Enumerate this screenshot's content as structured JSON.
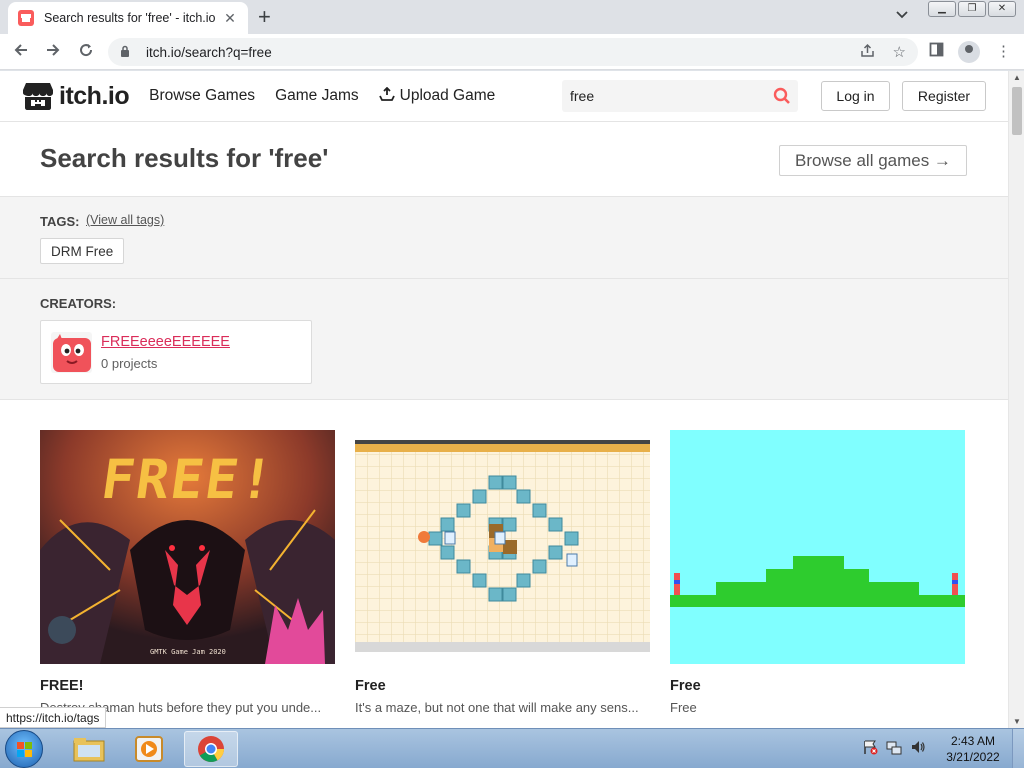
{
  "browser": {
    "tab_title": "Search results for 'free' - itch.io",
    "url": "itch.io/search?q=free",
    "status_url": "https://itch.io/tags"
  },
  "site": {
    "logo_text": "itch.io",
    "nav": {
      "browse_games": "Browse Games",
      "game_jams": "Game Jams",
      "upload_game": "Upload Game"
    },
    "search_value": "free",
    "login": "Log in",
    "register": "Register"
  },
  "results": {
    "title": "Search results for 'free'",
    "browse_all": "Browse all games →",
    "tags_label": "TAGS:",
    "view_all_tags": "(View all tags)",
    "tags": [
      "DRM Free"
    ],
    "creators_label": "CREATORS:",
    "creator": {
      "name": "FREEeeeeEEEEEE",
      "projects": "0 projects"
    },
    "games": [
      {
        "title": "FREE!",
        "desc": "Destroy shaman huts before they put you unde...",
        "thumb_text": "FREE!",
        "thumb_credit": "GMTK Game Jam 2020"
      },
      {
        "title": "Free",
        "desc": "It's a maze, but not one that will make any sens..."
      },
      {
        "title": "Free",
        "desc": "Free"
      }
    ]
  },
  "taskbar": {
    "time": "2:43 AM",
    "date": "3/21/2022"
  },
  "colors": {
    "brand": "#fa5c5c",
    "creator_link": "#da2c59"
  }
}
